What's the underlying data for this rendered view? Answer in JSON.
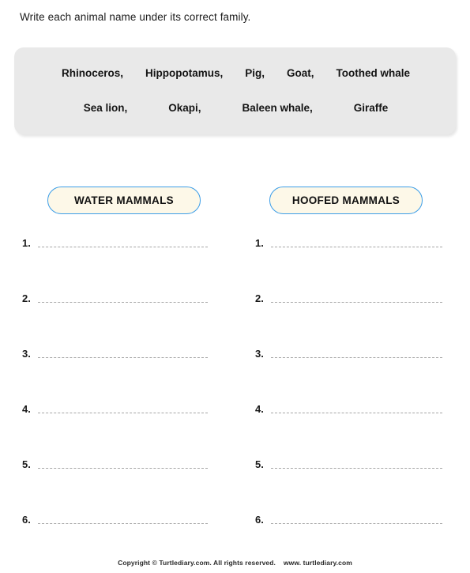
{
  "instruction": "Write each animal name under its correct family.",
  "word_bank": {
    "rows": [
      [
        "Rhinoceros,",
        "Hippopotamus,",
        "Pig,",
        "Goat,",
        "Toothed whale"
      ],
      [
        "Sea lion,",
        "Okapi,",
        "Baleen whale,",
        "Giraffe"
      ]
    ],
    "background_color": "#e9e9e9"
  },
  "categories": [
    {
      "label": "WATER MAMMALS",
      "fill_color": "#fdf8e8",
      "border_color": "#3d9ee8",
      "answer_lines": [
        "1.",
        "2.",
        "3.",
        "4.",
        "5.",
        "6."
      ]
    },
    {
      "label": "HOOFED MAMMALS",
      "fill_color": "#fdf8e8",
      "border_color": "#3d9ee8",
      "answer_lines": [
        "1.",
        "2.",
        "3.",
        "4.",
        "5.",
        "6."
      ]
    }
  ],
  "footer": {
    "copyright": "Copyright © Turtlediary.com. All rights reserved.",
    "website": "www. turtlediary.com"
  }
}
